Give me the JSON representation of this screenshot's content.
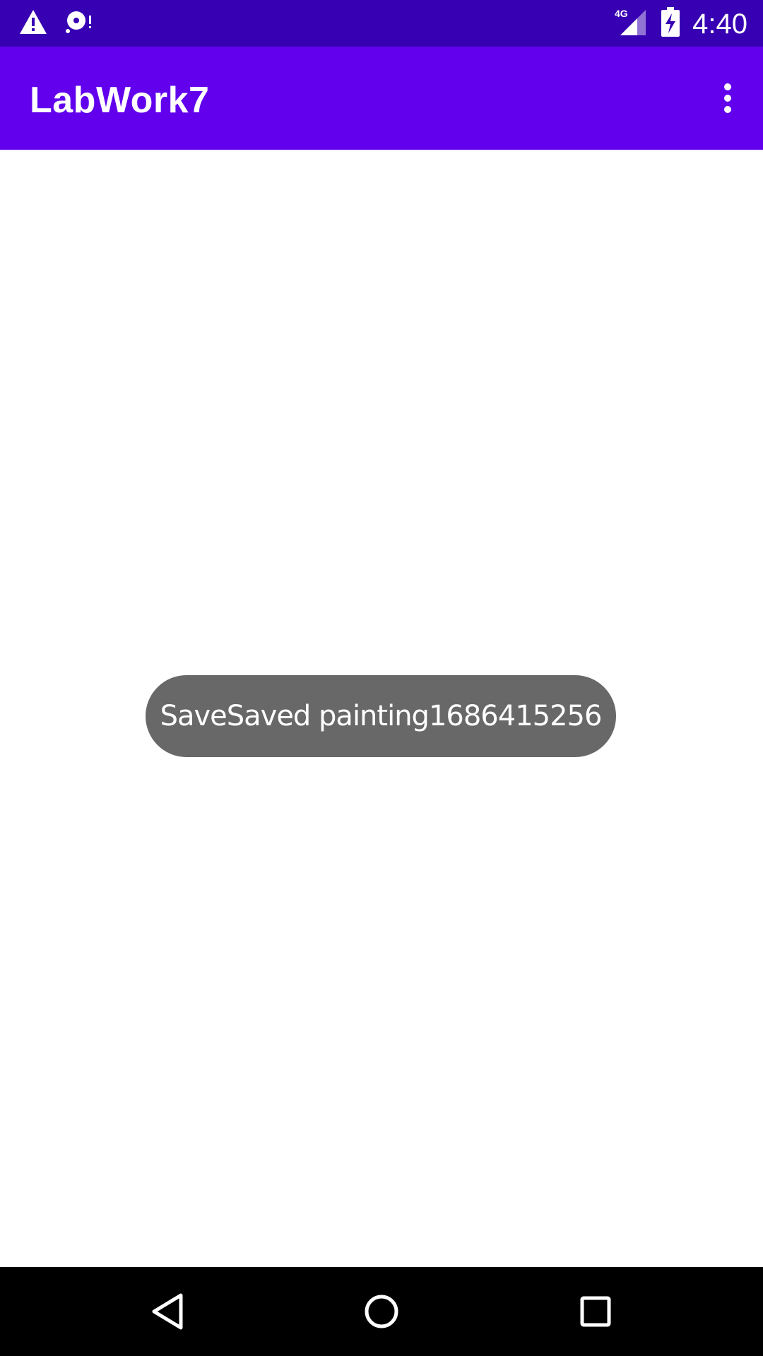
{
  "status_bar": {
    "time": "4:40",
    "network_label": "4G",
    "icons": [
      "warning-icon",
      "sd-card-alert-icon",
      "signal-icon",
      "battery-charging-icon"
    ],
    "background": "#3700B3"
  },
  "app_bar": {
    "title": "LabWork7",
    "background": "#6200EE",
    "overflow_icon": "more-vert-icon"
  },
  "toast": {
    "message": "SaveSaved painting1686415256",
    "background": "#686868"
  },
  "nav_bar": {
    "icons": [
      "back-icon",
      "home-icon",
      "recents-icon"
    ]
  }
}
